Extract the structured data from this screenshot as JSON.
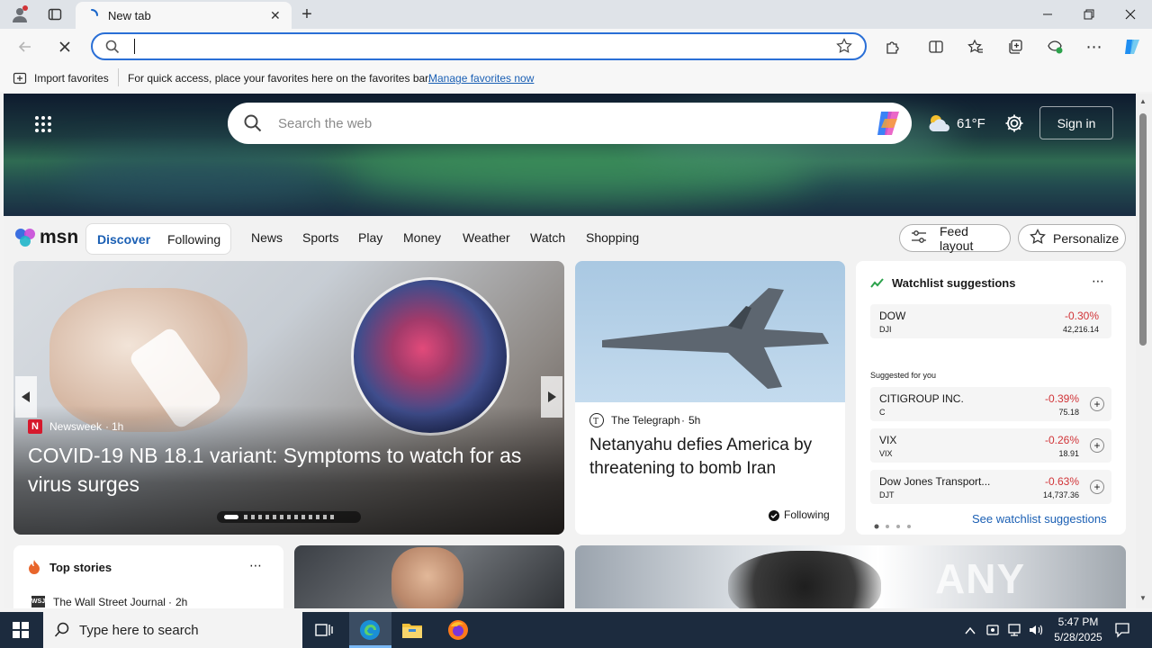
{
  "browser": {
    "tab_title": "New tab",
    "address_value": "",
    "favbar": {
      "import_label": "Import favorites",
      "hint": "For quick access, place your favorites here on the favorites bar.",
      "manage_link": "Manage favorites now"
    }
  },
  "msn": {
    "search_placeholder": "Search the web",
    "weather": "61°F",
    "sign_in": "Sign in",
    "logo": "msn",
    "nav": {
      "discover": "Discover",
      "following": "Following",
      "links": [
        "News",
        "Sports",
        "Play",
        "Money",
        "Weather",
        "Watch",
        "Shopping"
      ],
      "feed_layout": "Feed layout",
      "personalize": "Personalize"
    },
    "hero_story": {
      "source": "Newsweek",
      "age": "1h",
      "headline": "COVID-19 NB 18.1 variant: Symptoms to watch for as virus surges"
    },
    "second_story": {
      "source": "The Telegraph",
      "age": "5h",
      "headline": "Netanyahu defies America by threatening to bomb Iran",
      "following": "Following"
    },
    "watchlist": {
      "title": "Watchlist suggestions",
      "top": {
        "name": "DOW",
        "ticker": "DJI",
        "change": "-0.30%",
        "price": "42,216.14"
      },
      "suggested_label": "Suggested for you",
      "items": [
        {
          "name": "CITIGROUP INC.",
          "ticker": "C",
          "change": "-0.39%",
          "price": "75.18"
        },
        {
          "name": "VIX",
          "ticker": "VIX",
          "change": "-0.26%",
          "price": "18.91"
        },
        {
          "name": "Dow Jones Transport...",
          "ticker": "DJT",
          "change": "-0.63%",
          "price": "14,737.36"
        }
      ],
      "see_link": "See watchlist suggestions"
    },
    "top_stories": {
      "title": "Top stories",
      "first_source": "The Wall Street Journal",
      "first_age": "2h"
    },
    "watermark": "ANY RUN"
  },
  "taskbar": {
    "search_placeholder": "Type here to search",
    "time": "5:47 PM",
    "date": "5/28/2025"
  },
  "colors": {
    "accent": "#2a6fd6",
    "negative": "#d13438",
    "taskbar": "#1c2b3e"
  }
}
